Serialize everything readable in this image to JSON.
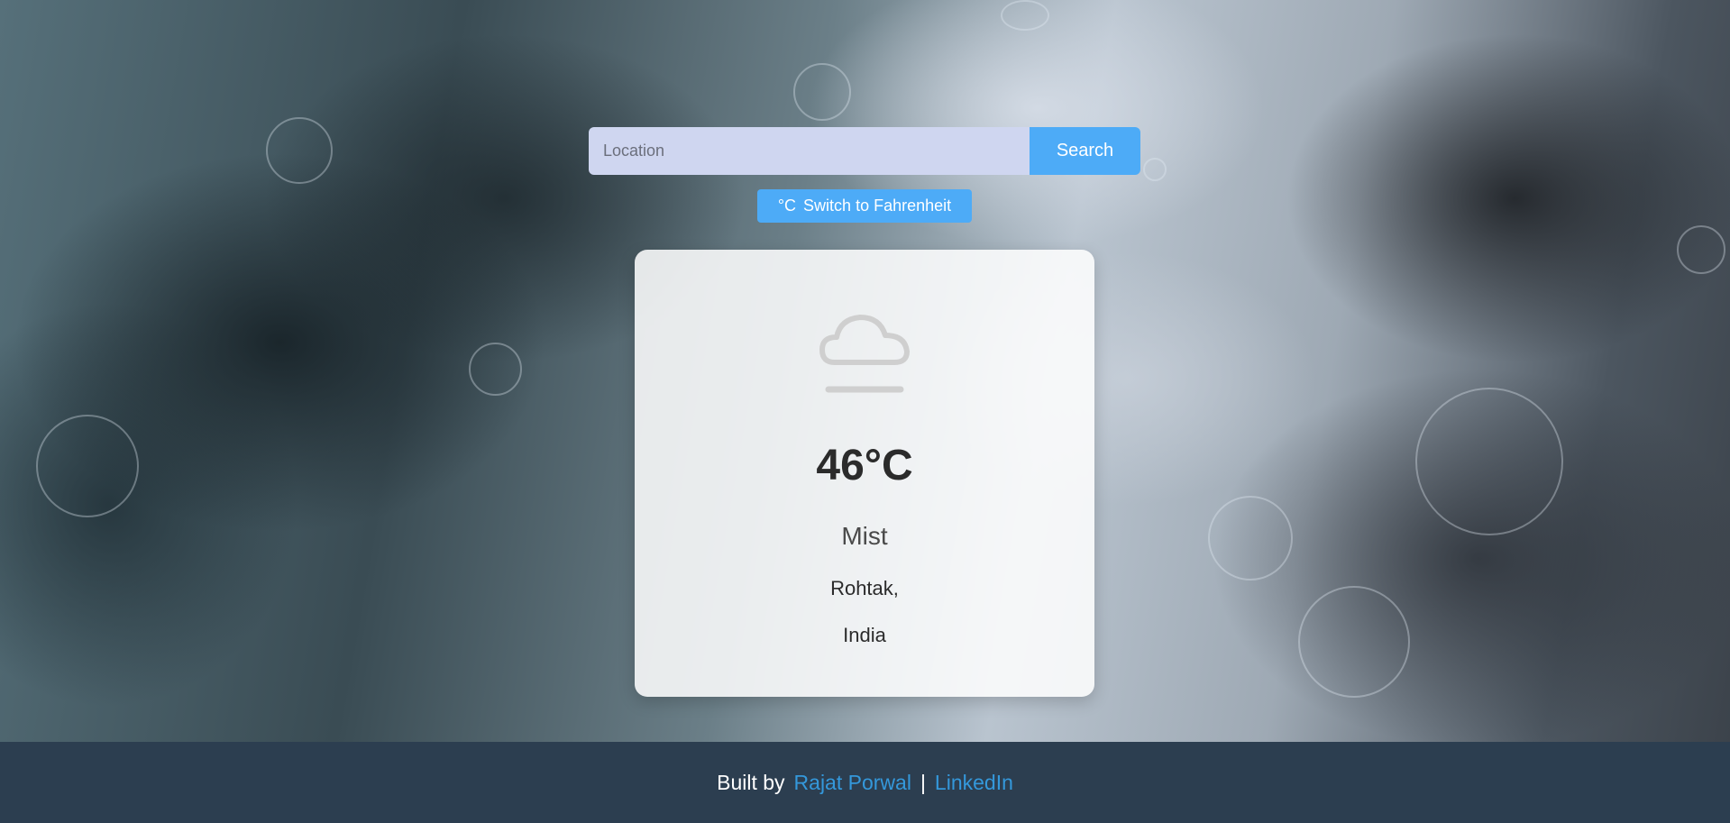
{
  "search": {
    "placeholder": "Location",
    "button_label": "Search"
  },
  "unit_toggle": {
    "unit_symbol": "°C",
    "label": "Switch to Fahrenheit"
  },
  "weather": {
    "icon": "cloud-mist-icon",
    "temperature": "46°C",
    "condition": "Mist",
    "city": "Rohtak,",
    "country": "India"
  },
  "footer": {
    "built_by": "Built by",
    "author": "Rajat Porwal",
    "separator": "|",
    "linkedin": "LinkedIn"
  },
  "colors": {
    "accent": "#4dabf7",
    "input_bg": "#cfd6f0",
    "footer_bg": "#2c3e50",
    "link": "#3498db"
  }
}
